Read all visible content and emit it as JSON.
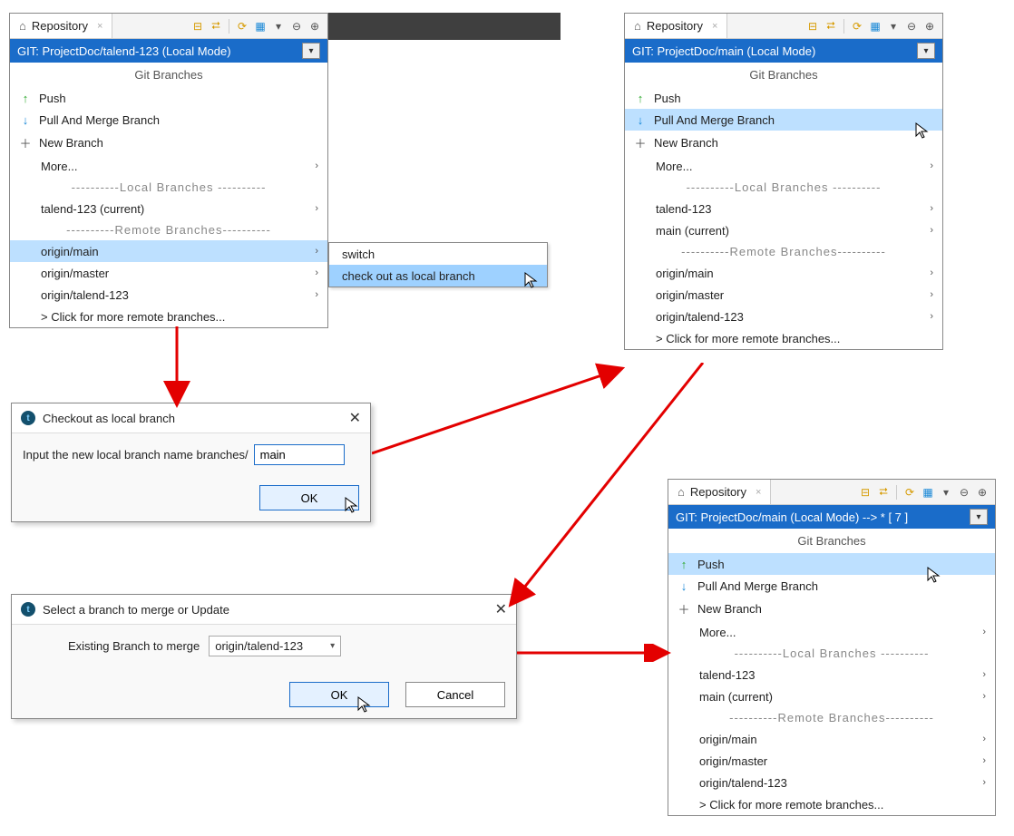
{
  "panel1": {
    "tab_label": "Repository",
    "git_bar": "GIT: ProjectDoc/talend-123   (Local Mode)",
    "header": "Git Branches",
    "push": "Push",
    "pull": "Pull And Merge Branch",
    "newbranch": "New Branch",
    "more": "More...",
    "local_hdr": "----------Local   Branches  ----------",
    "local1": "talend-123 (current)",
    "remote_hdr": "----------Remote Branches----------",
    "r1": "origin/main",
    "r2": "origin/master",
    "r3": "origin/talend-123",
    "moreremote": " > Click for more remote branches..."
  },
  "submenu": {
    "switch": "switch",
    "checkout": "check out as local branch"
  },
  "dialog1": {
    "title": "Checkout as local branch",
    "label": "Input the new local branch name branches/",
    "value": "main",
    "ok": "OK"
  },
  "panel2": {
    "tab_label": "Repository",
    "git_bar": "GIT: ProjectDoc/main   (Local Mode)",
    "header": "Git Branches",
    "push": "Push",
    "pull": "Pull And Merge Branch",
    "newbranch": "New Branch",
    "more": "More...",
    "local_hdr": "----------Local   Branches  ----------",
    "local1": "talend-123",
    "local2": "main (current)",
    "remote_hdr": "----------Remote Branches----------",
    "r1": "origin/main",
    "r2": "origin/master",
    "r3": "origin/talend-123",
    "moreremote": " > Click for more remote branches..."
  },
  "dialog2": {
    "title": "Select a branch to merge or Update",
    "label": "Existing Branch to merge",
    "selected": "origin/talend-123",
    "ok": "OK",
    "cancel": "Cancel"
  },
  "panel3": {
    "tab_label": "Repository",
    "git_bar": "GIT: ProjectDoc/main   (Local Mode)    --> * [ 7 ]",
    "header": "Git Branches",
    "push": "Push",
    "pull": "Pull And Merge Branch",
    "newbranch": "New Branch",
    "more": "More...",
    "local_hdr": "----------Local   Branches  ----------",
    "local1": "talend-123",
    "local2": "main (current)",
    "remote_hdr": "----------Remote Branches----------",
    "r1": "origin/main",
    "r2": "origin/master",
    "r3": "origin/talend-123",
    "moreremote": " > Click for more remote branches..."
  }
}
